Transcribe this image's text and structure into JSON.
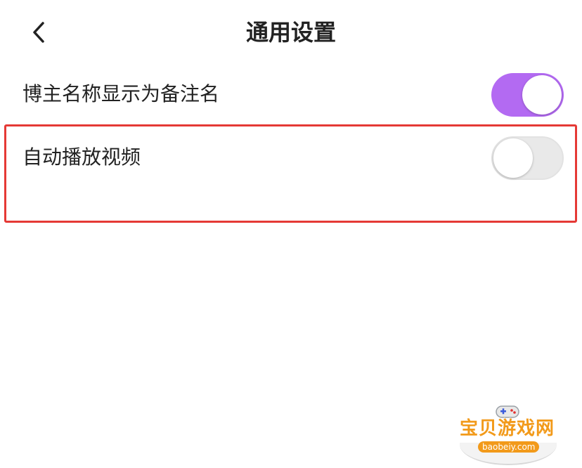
{
  "header": {
    "title": "通用设置"
  },
  "settings": [
    {
      "label": "博主名称显示为备注名",
      "enabled": true
    },
    {
      "label": "自动播放视频",
      "enabled": false
    }
  ],
  "colors": {
    "toggle_on": "#b36af2",
    "toggle_off": "#e9e9e9",
    "highlight": "#e53935"
  },
  "watermark": {
    "title": "宝贝游戏网",
    "url": "baobeiy.com"
  }
}
